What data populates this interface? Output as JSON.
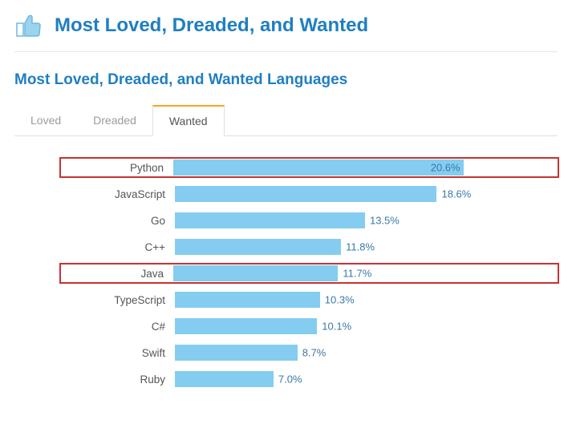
{
  "header": {
    "title": "Most Loved, Dreaded, and Wanted"
  },
  "section": {
    "title": "Most Loved, Dreaded, and Wanted Languages"
  },
  "tabs": [
    {
      "label": "Loved",
      "active": false
    },
    {
      "label": "Dreaded",
      "active": false
    },
    {
      "label": "Wanted",
      "active": true
    }
  ],
  "chart_data": {
    "type": "bar",
    "title": "Most Loved, Dreaded, and Wanted Languages — Wanted",
    "xlabel": "",
    "ylabel": "",
    "ylim": [
      0,
      25
    ],
    "categories": [
      "Python",
      "JavaScript",
      "Go",
      "C++",
      "Java",
      "TypeScript",
      "C#",
      "Swift",
      "Ruby"
    ],
    "values": [
      20.6,
      18.6,
      13.5,
      11.8,
      11.7,
      10.3,
      10.1,
      8.7,
      7.0
    ],
    "value_labels": [
      "20.6%",
      "18.6%",
      "13.5%",
      "11.8%",
      "11.7%",
      "10.3%",
      "10.1%",
      "8.7%",
      "7.0%"
    ],
    "highlighted": [
      "Python",
      "Java"
    ],
    "value_inside": [
      "Python"
    ]
  }
}
